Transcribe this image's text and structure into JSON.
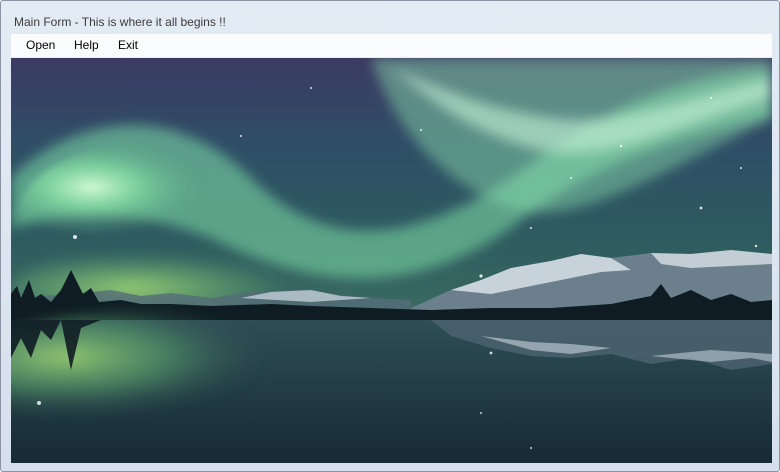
{
  "window": {
    "title": "Main Form - This is where it all begins !!"
  },
  "menu": {
    "items": [
      "Open",
      "Help",
      "Exit"
    ]
  },
  "image": {
    "subject": "aurora borealis over a lake with mountains",
    "icon": "landscape-photo"
  }
}
